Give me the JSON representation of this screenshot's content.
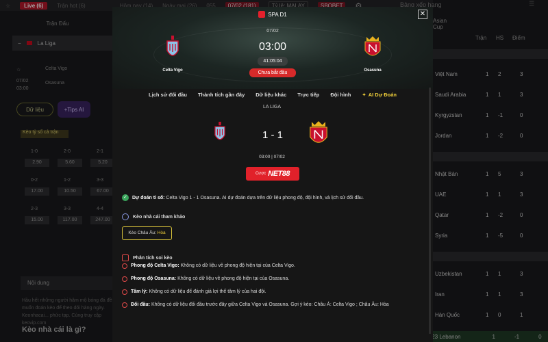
{
  "topnav": {
    "live": "Live (6)",
    "tran_hot": "Trận hot (6)",
    "tab_hom_nay": "Hôm nay (14)",
    "tab_ngay_mai": "Ngày mai (26)",
    "tab_055": "055",
    "tab_date": "07/02 (181)",
    "odds_select": "Tỷ lệ: MALAY",
    "bookmaker": "SBOBET",
    "icons": [
      "star-icon",
      "gear-icon"
    ]
  },
  "left": {
    "tran_dau": "Trận Đấu",
    "league": "La Liga",
    "home": "Celta Vigo",
    "away": "Osasuna",
    "date": "07/02",
    "time": "03:00",
    "btn_du_lieu": "Dữ liệu",
    "btn_tips": "Tips AI",
    "odds_tab": "Kèo tỷ số cả trận",
    "odds": [
      {
        "label": "1-0",
        "value": "2.90"
      },
      {
        "label": "2-0",
        "value": "5.60"
      },
      {
        "label": "2-1",
        "value": "5.20"
      },
      {
        "label": "0-2",
        "value": "17.00"
      },
      {
        "label": "1-2",
        "value": "10.50"
      },
      {
        "label": "3-3",
        "value": "67.00"
      },
      {
        "label": "2-3",
        "value": "15.00"
      },
      {
        "label": "3-3",
        "value": "117.00"
      },
      {
        "label": "4-4",
        "value": "247.00"
      }
    ],
    "noi_dung": "Nội dung",
    "article": "Hầu hết những người hâm mộ bóng đá đều muốn đoán kèo để theo dõi hàng ngày. Keonhacai... phức tạp. Cùng truy cập keovip.com",
    "heading": "Kèo nhà cái là gì?"
  },
  "right": {
    "title": "Bảng xếp hạng",
    "tab": "Asian Cup",
    "col_tran": "Trận",
    "col_hs": "HS",
    "col_diem": "Điểm",
    "teams": [
      {
        "name": "Việt Nam",
        "p": "1",
        "hs": "2",
        "d": "3"
      },
      {
        "name": "Saudi Arabia",
        "p": "1",
        "hs": "1",
        "d": "3"
      },
      {
        "name": "Kyrgyzstan",
        "p": "1",
        "hs": "-1",
        "d": "0"
      },
      {
        "name": "Jordan",
        "p": "1",
        "hs": "-2",
        "d": "0"
      },
      {
        "name": "Nhật Bản",
        "p": "1",
        "hs": "5",
        "d": "3"
      },
      {
        "name": "UAE",
        "p": "1",
        "hs": "1",
        "d": "3"
      },
      {
        "name": "Qatar",
        "p": "1",
        "hs": "-2",
        "d": "0"
      },
      {
        "name": "Syria",
        "p": "1",
        "hs": "-5",
        "d": "0"
      },
      {
        "name": "Uzbekistan",
        "p": "1",
        "hs": "1",
        "d": "3"
      },
      {
        "name": "Iran",
        "p": "1",
        "hs": "1",
        "d": "3"
      },
      {
        "name": "Hàn Quốc",
        "p": "1",
        "hs": "0",
        "d": "1"
      },
      {
        "name": "U23 Lebanon",
        "p": "1",
        "hs": "-1",
        "d": "0"
      }
    ],
    "lebanon_rank": "4"
  },
  "modal": {
    "league_badge": "SPA D1",
    "date": "07/02",
    "time": "03:00",
    "countdown": "41:05:04",
    "status": "Chưa bắt đầu",
    "home": "Celta Vigo",
    "away": "Osasuna",
    "tabs": [
      "Lịch sử đối đầu",
      "Thành tích gần đây",
      "Dữ liệu khác",
      "Trực tiếp",
      "Đội hình",
      "AI Dự Đoán"
    ],
    "league": "LA LIGA",
    "score": "1 - 1",
    "kickoff": "03:00 | 07/02",
    "bet_prefix": "Cược",
    "bet_brand": "NET88",
    "prediction_label": "Dự đoán tỉ số:",
    "prediction_text": "Celta Vigo 1 - 1 Osasuna. AI dự đoán dựa trên dữ liệu phong độ, đội hình, và lịch sử đối đầu.",
    "ref_title": "Kèo nhà cái tham khảo",
    "chau_au_label": "Kèo Châu Âu:",
    "chau_au_value": "Hòa",
    "analysis_title": "Phân tích soi kèo",
    "analysis": [
      {
        "label": "Phong độ Celta Vigo:",
        "text": "Không có dữ liệu về phong độ hiện tại của Celta Vigo."
      },
      {
        "label": "Phong độ Osasuna:",
        "text": "Không có dữ liệu về phong độ hiện tại của Osasuna."
      },
      {
        "label": "Tâm lý:",
        "text": "Không có dữ liệu để đánh giá lợi thế tâm lý của hai đội."
      },
      {
        "label": "Đối đầu:",
        "text": "Không có dữ liệu đối đầu trước đây giữa Celta Vigo và Osasuna. Gợi ý kèo: Châu Á: Celta Vigo ; Châu Âu: Hòa"
      }
    ],
    "colors": {
      "accent_red": "#d72a2a",
      "accent_yellow": "#f4d23a",
      "check_green": "#3aa55c"
    }
  }
}
